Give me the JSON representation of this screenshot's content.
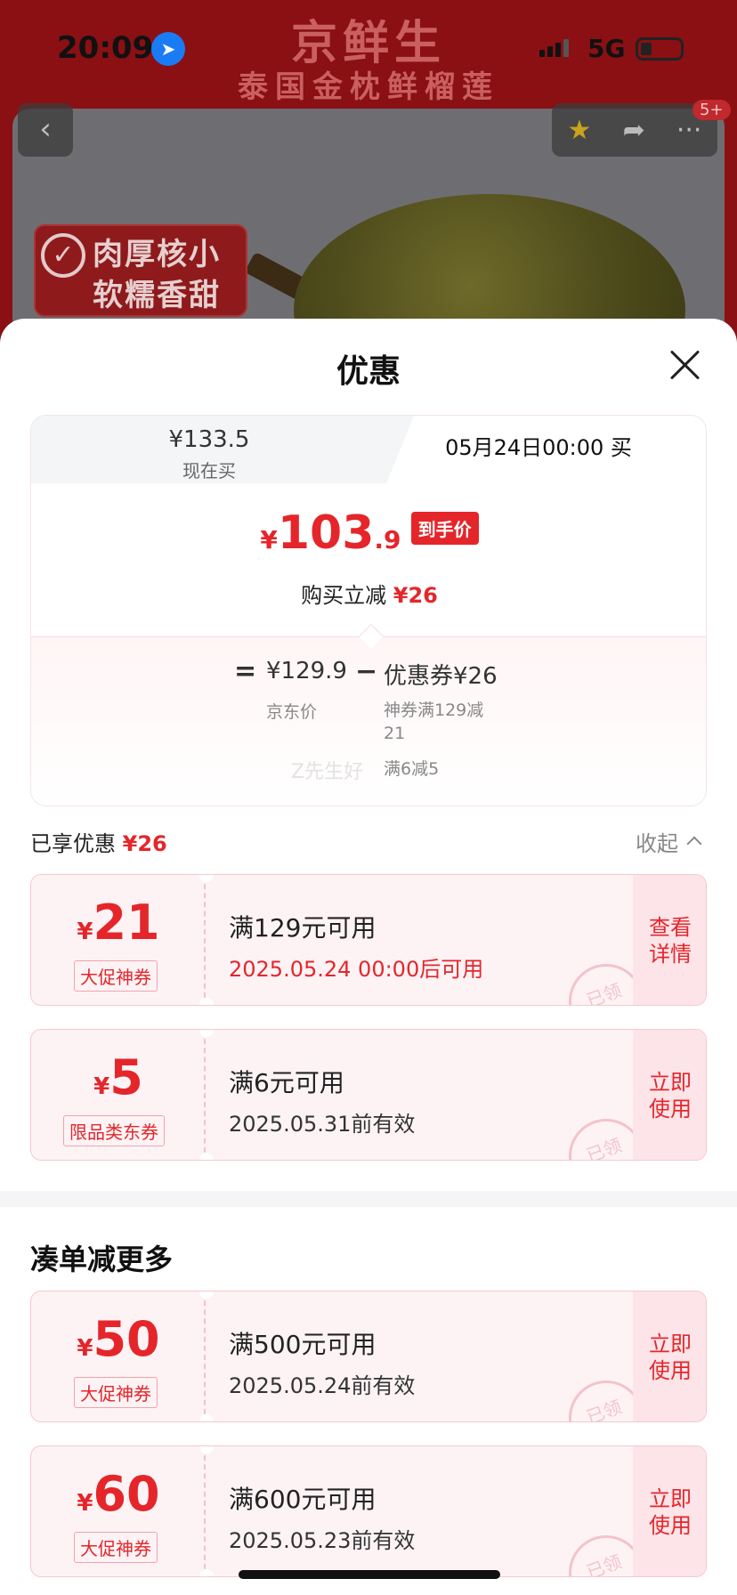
{
  "status_bar": {
    "time": "20:09",
    "network": "5G"
  },
  "background": {
    "title_line1": "京鲜生",
    "title_line2": "泰国金枕鲜榴莲",
    "tag_line1": "肉厚核小",
    "tag_line2": "软糯香甜",
    "cart_badge": "5+"
  },
  "sheet": {
    "title": "优惠",
    "tabs": {
      "now_price": "¥133.5",
      "now_label": "现在买",
      "later_label": "05月24日00:00 买"
    },
    "final": {
      "yen": "¥",
      "integer": "103",
      "decimal": ".9",
      "tag": "到手价",
      "reduce_label": "购买立减",
      "reduce_amount": "¥26"
    },
    "breakdown": {
      "equals": "=",
      "jd_price": "¥129.9",
      "minus": "−",
      "coupon_label": "优惠券¥26",
      "jd_price_label": "京东价",
      "coupon_detail_1": "神券满129减21",
      "coupon_detail_2": "满6减5",
      "watermark": "Z先生好"
    },
    "enjoyed": {
      "label": "已享优惠",
      "amount": "¥26",
      "collapse": "收起"
    },
    "coupons": [
      {
        "yen": "¥",
        "amount": "21",
        "type": "大促神券",
        "condition": "满129元可用",
        "validity": "2025.05.24 00:00后可用",
        "action": "查看详情",
        "stamp": "已领"
      },
      {
        "yen": "¥",
        "amount": "5",
        "type": "限品类东券",
        "condition": "满6元可用",
        "validity": "2025.05.31前有效",
        "action": "立即使用",
        "stamp": "已领"
      }
    ],
    "more": {
      "title": "凑单减更多",
      "coupons": [
        {
          "yen": "¥",
          "amount": "50",
          "type": "大促神券",
          "condition": "满500元可用",
          "validity": "2025.05.24前有效",
          "action": "立即使用",
          "stamp": "已领"
        },
        {
          "yen": "¥",
          "amount": "60",
          "type": "大促神券",
          "condition": "满600元可用",
          "validity": "2025.05.23前有效",
          "action": "立即使用",
          "stamp": "已领"
        }
      ]
    }
  },
  "colors": {
    "accent": "#e4262b",
    "coupon_bg": "#fdf3f5",
    "action_bg": "#fce4e8"
  },
  "icons": [
    "location-arrow-icon",
    "back-arrow-icon",
    "star-icon",
    "share-icon",
    "more-icon",
    "close-icon",
    "chevron-up-icon",
    "check-circle-icon"
  ]
}
